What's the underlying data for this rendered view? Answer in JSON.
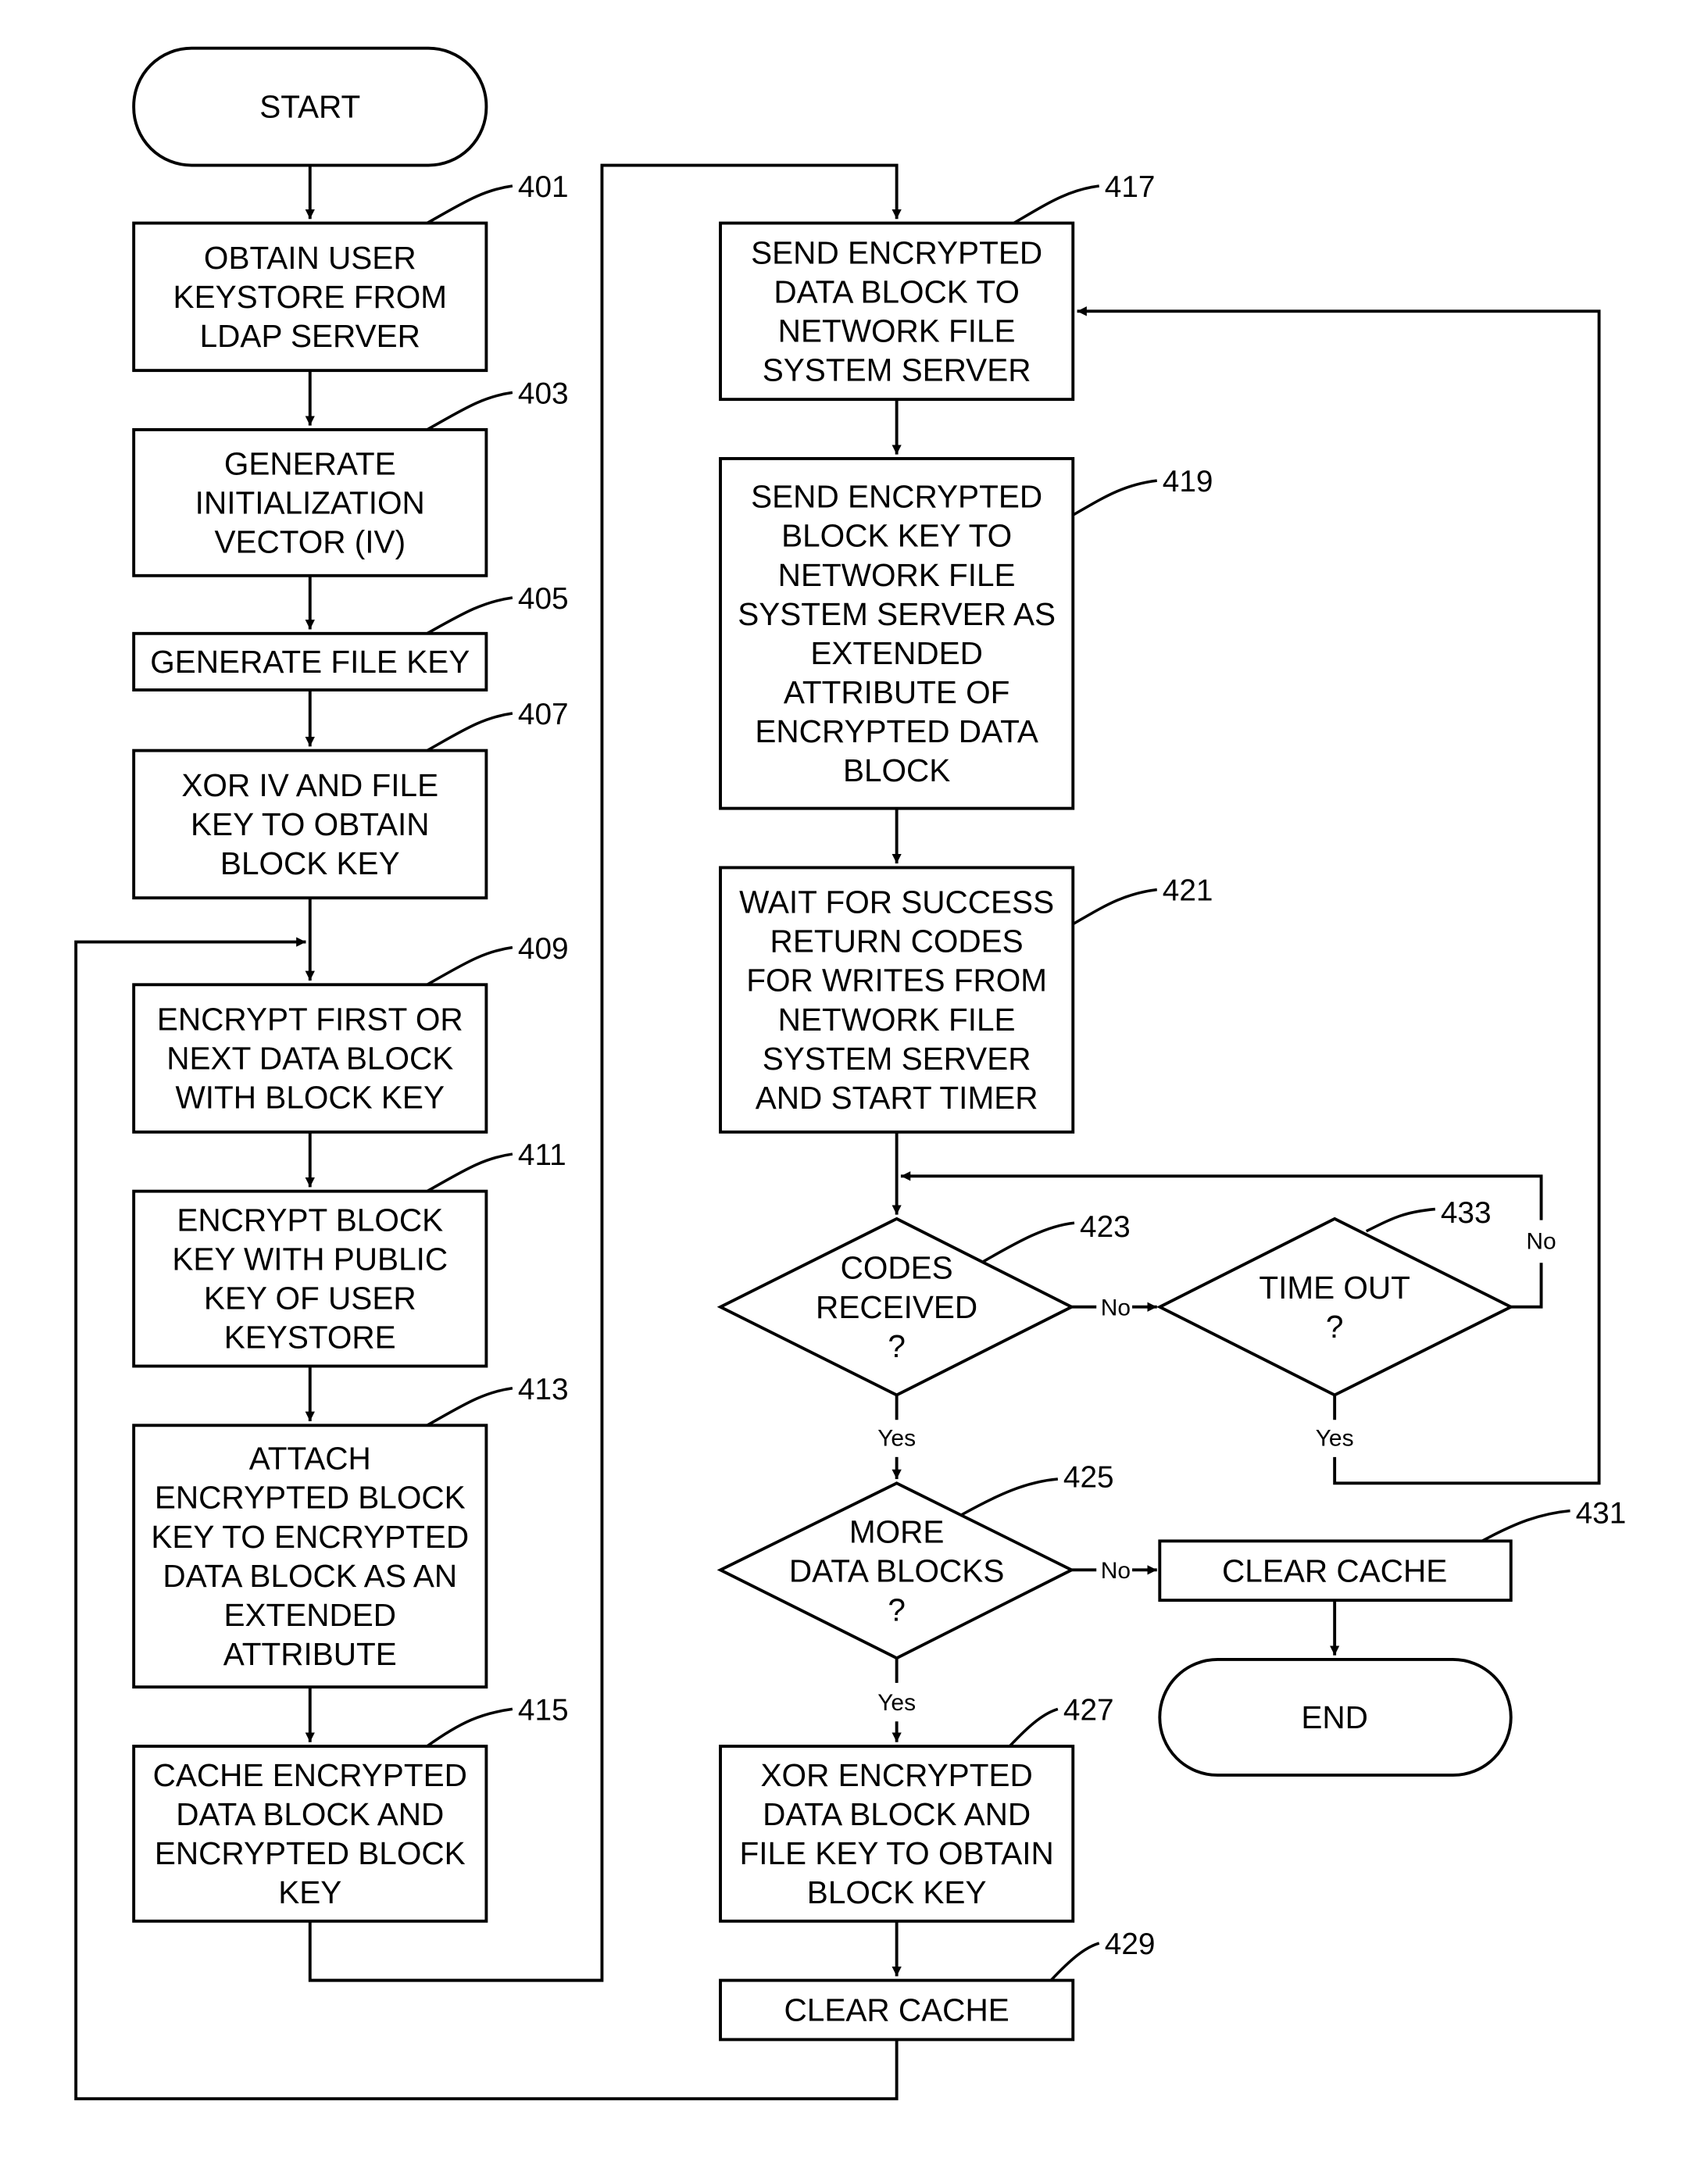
{
  "diagram": {
    "type": "flowchart",
    "colors": {
      "stroke": "#000000",
      "background": "#ffffff"
    },
    "nodes": {
      "start": {
        "lines": [
          "START"
        ]
      },
      "n401": {
        "ref": "401",
        "lines": [
          "OBTAIN USER",
          "KEYSTORE  FROM",
          "LDAP  SERVER"
        ]
      },
      "n403": {
        "ref": "403",
        "lines": [
          "GENERATE",
          "INITIALIZATION",
          "VECTOR (IV)"
        ]
      },
      "n405": {
        "ref": "405",
        "lines": [
          "GENERATE FILE KEY"
        ]
      },
      "n407": {
        "ref": "407",
        "lines": [
          "XOR IV AND FILE",
          "KEY TO OBTAIN",
          "BLOCK KEY"
        ]
      },
      "n409": {
        "ref": "409",
        "lines": [
          "ENCRYPT FIRST OR",
          "NEXT DATA BLOCK",
          "WITH BLOCK KEY"
        ]
      },
      "n411": {
        "ref": "411",
        "lines": [
          "ENCRYPT  BLOCK",
          "KEY WITH PUBLIC",
          "KEY OF USER",
          "KEYSTORE"
        ]
      },
      "n413": {
        "ref": "413",
        "lines": [
          "ATTACH",
          "ENCRYPTED  BLOCK",
          "KEY TO ENCRYPTED",
          "DATA BLOCK AS AN",
          "EXTENDED",
          "ATTRIBUTE"
        ]
      },
      "n415": {
        "ref": "415",
        "lines": [
          "CACHE  ENCRYPTED",
          "DATA BLOCK AND",
          "ENCRYPTED  BLOCK",
          "KEY"
        ]
      },
      "n417": {
        "ref": "417",
        "lines": [
          "SEND  ENCRYPTED",
          "DATA BLOCK TO",
          "NETWORK FILE",
          "SYSTEM  SERVER"
        ]
      },
      "n419": {
        "ref": "419",
        "lines": [
          "SEND  ENCRYPTED",
          "BLOCK KEY TO",
          "NETWORK FILE",
          "SYSTEM SERVER AS",
          "EXTENDED",
          "ATTRIBUTE  OF",
          "ENCRYPTED  DATA",
          "BLOCK"
        ]
      },
      "n421": {
        "ref": "421",
        "lines": [
          "WAIT FOR SUCCESS",
          "RETURN  CODES",
          "FOR WRITES FROM",
          "NETWORK FILE",
          "SYSTEM  SERVER",
          "AND START TIMER"
        ]
      },
      "n423": {
        "ref": "423",
        "lines": [
          "CODES",
          "RECEIVED",
          "?"
        ]
      },
      "n433": {
        "ref": "433",
        "lines": [
          "TIME OUT",
          "?"
        ]
      },
      "n425": {
        "ref": "425",
        "lines": [
          "MORE",
          "DATA  BLOCKS",
          "?"
        ]
      },
      "n431": {
        "ref": "431",
        "lines": [
          "CLEAR CACHE"
        ]
      },
      "end": {
        "lines": [
          "END"
        ]
      },
      "n427": {
        "ref": "427",
        "lines": [
          "XOR ENCRYPTED",
          "DATA BLOCK AND",
          "FILE KEY TO OBTAIN",
          "BLOCK KEY"
        ]
      },
      "n429": {
        "ref": "429",
        "lines": [
          "CLEAR CACHE"
        ]
      }
    },
    "edge_labels": {
      "e423_no": "No",
      "e423_yes": "Yes",
      "e433_no": "No",
      "e433_yes": "Yes",
      "e425_no": "No",
      "e425_yes": "Yes"
    },
    "edges": [
      [
        "start",
        "n401"
      ],
      [
        "n401",
        "n403"
      ],
      [
        "n403",
        "n405"
      ],
      [
        "n405",
        "n407"
      ],
      [
        "n407",
        "n409"
      ],
      [
        "n409",
        "n411"
      ],
      [
        "n411",
        "n413"
      ],
      [
        "n413",
        "n415"
      ],
      [
        "n415",
        "n417"
      ],
      [
        "n417",
        "n419"
      ],
      [
        "n419",
        "n421"
      ],
      [
        "n421",
        "n423"
      ],
      [
        "n423",
        "n433",
        "No"
      ],
      [
        "n423",
        "n425",
        "Yes"
      ],
      [
        "n433",
        "n423",
        "No"
      ],
      [
        "n433",
        "n417",
        "Yes"
      ],
      [
        "n425",
        "n431",
        "No"
      ],
      [
        "n425",
        "n427",
        "Yes"
      ],
      [
        "n431",
        "end"
      ],
      [
        "n427",
        "n429"
      ],
      [
        "n429",
        "n409"
      ]
    ]
  }
}
